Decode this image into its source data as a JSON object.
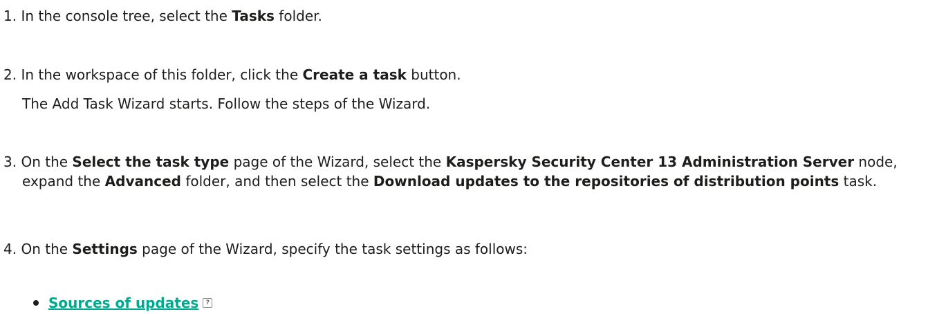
{
  "steps": [
    {
      "num": "1.",
      "parts": [
        {
          "t": "In the console tree, select the "
        },
        {
          "t": "Tasks",
          "b": true
        },
        {
          "t": " folder."
        }
      ]
    },
    {
      "num": "2.",
      "parts": [
        {
          "t": "In the workspace of this folder, click the "
        },
        {
          "t": "Create a task",
          "b": true
        },
        {
          "t": " button."
        }
      ],
      "note": "The Add Task Wizard starts. Follow the steps of the Wizard."
    },
    {
      "num": "3.",
      "parts": [
        {
          "t": "On the "
        },
        {
          "t": "Select the task type",
          "b": true
        },
        {
          "t": " page of the Wizard, select the "
        },
        {
          "t": "Kaspersky Security Center 13 Administration Server",
          "b": true
        },
        {
          "t": " node, expand the "
        },
        {
          "t": "Advanced",
          "b": true
        },
        {
          "t": " folder, and then select the "
        },
        {
          "t": "Download updates to the repositories of distribution points",
          "b": true
        },
        {
          "t": " task."
        }
      ]
    },
    {
      "num": "4.",
      "parts": [
        {
          "t": "On the "
        },
        {
          "t": "Settings",
          "b": true
        },
        {
          "t": " page of the Wizard, specify the task settings as follows:"
        }
      ]
    }
  ],
  "bullet": {
    "link_label": "Sources of updates",
    "help_glyph": "?",
    "icon": "help-icon"
  },
  "colors": {
    "text": "#1d1d1b",
    "link": "#00a88e"
  }
}
